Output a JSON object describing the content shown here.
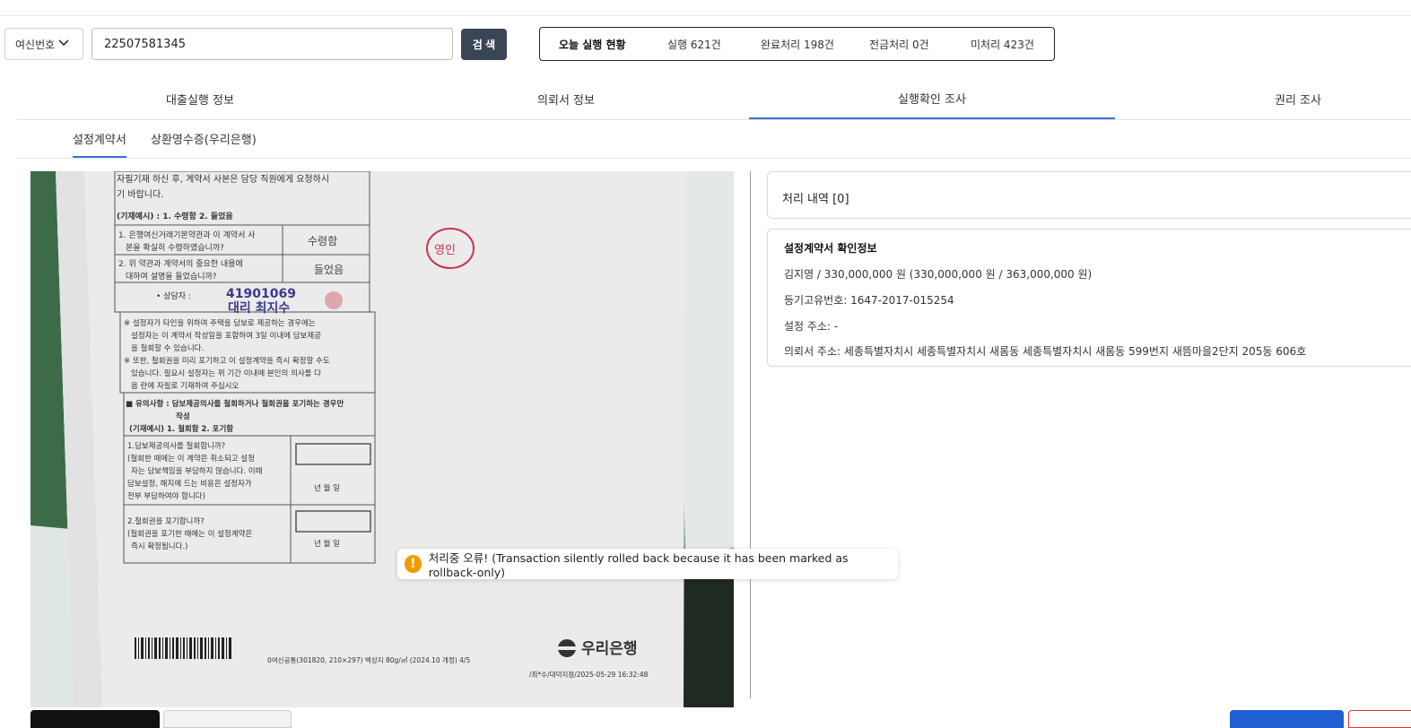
{
  "search": {
    "field_select": "여신번호",
    "query_value": "22507581345",
    "button_label": "검 색"
  },
  "today_status": {
    "title": "오늘 실행 현황",
    "executed": "실행 621건",
    "completed": "완료처리 198건",
    "transferred": "전금처리 0건",
    "unprocessed": "미처리 423건"
  },
  "main_tabs": [
    {
      "label": "대출실행 정보"
    },
    {
      "label": "의뢰서 정보"
    },
    {
      "label": "실행확인 조사"
    },
    {
      "label": "권리 조사"
    }
  ],
  "sub_tabs": [
    {
      "label": "설정계약서"
    },
    {
      "label": "상환영수증(우리은행)"
    }
  ],
  "document": {
    "line_1": "자필기재 하신 후, 계약서 사본은 담당 직원에게 요청하시",
    "line_2": "기 바랍니다.",
    "example_1": "(기재예시) : 1. 수령함   2. 들었음",
    "q1": "1. 은행여신거래기본약관과 이 계약서 사",
    "q1b": "본을 확실히 수령하였습니까?",
    "a1": "수령함",
    "q2": "2. 위 약관과 계약서의 중요한 내용에",
    "q2b": "대하여 설명을 들었습니까?",
    "a2": "들었음",
    "officer_label": "• 상담자 :",
    "officer_id": "41901069",
    "officer_name": "대리 최지수",
    "stamp": "영인",
    "notice_1": "※ 설정자가 타인을 위하여 주택을 담보로 제공하는 경우에는",
    "notice_2": "설정자는 이 계약서 작성일을 포함하여 3일 이내에 담보제공",
    "notice_3": "을 철회할 수 있습니다.",
    "notice_4": "※ 또한, 철회권을 미리 포기하고 이 설정계약을 즉시 확정할 수도",
    "notice_5": "있습니다. 필요시 설정자는 위 기간 이내에 본인의 의사를 다",
    "notice_6": "음 란에 자필로 기재하여 주십시오",
    "caution_1": "■ 유의사항 : 담보제공의사를 철회하거나 철회권을 포기하는 경우만",
    "caution_2": "작성",
    "example_2": "(기재예시) 1. 철회함  2. 포기함",
    "w1": "1.담보제공의사를 철회합니까?",
    "w2": "(철회한 때에는 이 계약은 취소되고 설정",
    "w3": "자는 담보책임을 부담하지 않습니다. 이때",
    "w4": "담보설정, 해지에 드는 비용은 설정자가",
    "w5": "전부 부담하여야 합니다)",
    "date_1": "년   월   일",
    "p1": "2.철회권을 포기합니까?",
    "p2": "(철회권을 포기한 때에는 이 설정계약은",
    "p3": "즉시 확정됩니다.)",
    "date_2": "년   월   일",
    "form_code": "0여신공통(301820, 210×297) 백상지 80g/㎡ (2024.10 개정)   4/5",
    "bank_logo": "우리은행",
    "footer_stamp": "/최*수/대덕지점/2025-05-29 16:32:48"
  },
  "right_panel": {
    "history_title": "처리 내역 [0]",
    "info_title": "설정계약서 확인정보",
    "borrower_line": "김지영 / 330,000,000 원 (330,000,000 원 / 363,000,000 원)",
    "registry_line": "등기고유번호: 1647-2017-015254",
    "setup_address": "설정 주소: -",
    "request_address": "의뢰서 주소: 세종특별자치시 세종특별자치시 새롬동   세종특별자치시 새롬동 599번지 새뜸마을2단지 205동 606호"
  },
  "toast": {
    "icon": "warning-icon",
    "message": "처리중 오류! (Transaction silently rolled back because it has been marked as rollback-only)"
  },
  "colors": {
    "accent": "#3b6fd9",
    "search_button": "#3a4556",
    "warning": "#f29b00",
    "primary_button": "#1f5fd1"
  }
}
